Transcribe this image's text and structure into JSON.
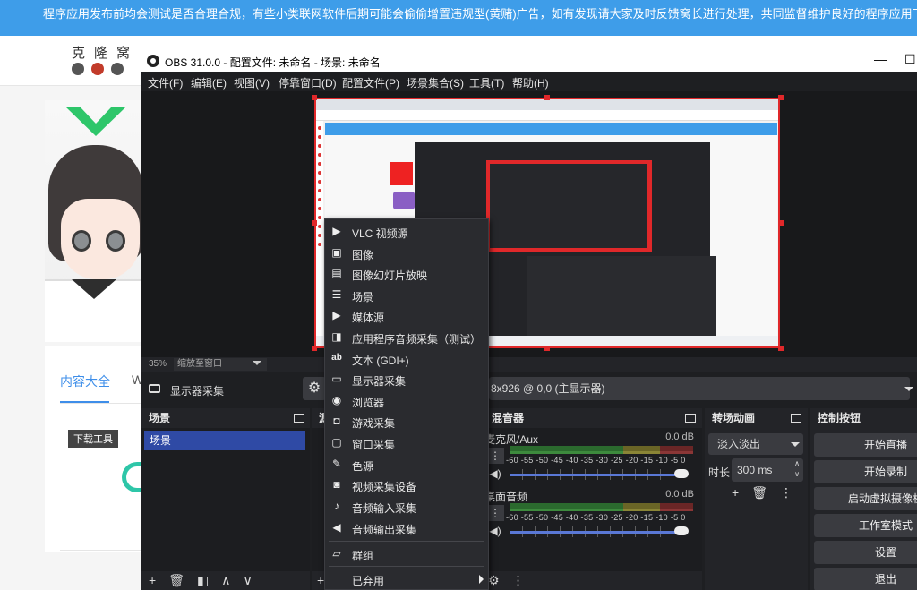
{
  "site": {
    "banner": "程序应用发布前均会测试是否合理合规，有些小类联网软件后期可能会偷偷增置违规型(黄赌)广告，如有发现请大家及时反馈窝长进行处理，共同监督维护良好的程序应用下载社区！",
    "logo": "克隆窝",
    "tab_active": "内容大全",
    "tab_other": "W",
    "tag": "下载工具"
  },
  "obs": {
    "title": "OBS 31.0.0 - 配置文件: 未命名 - 场景: 未命名",
    "minimize": "—",
    "maximize": "☐",
    "menu": [
      "文件(F)",
      "编辑(E)",
      "视图(V)",
      "停靠窗口(D)",
      "配置文件(P)",
      "场景集合(S)",
      "工具(T)",
      "帮助(H)"
    ],
    "zoom_percent": "35%",
    "zoom_mode": "缩放至窗口",
    "source_name": "显示器采集",
    "display_value": "8x926 @ 0,0 (主显示器)",
    "docks": {
      "scenes_title": "场景",
      "sources_title": "源",
      "mixer_title": "混音器",
      "transitions_title": "转场动画",
      "controls_title": "控制按钮"
    },
    "scene_item": "场景",
    "mixer": [
      {
        "name": "麦克风/Aux",
        "db": "0.0 dB"
      },
      {
        "name": "桌面音频",
        "db": "0.0 dB"
      }
    ],
    "meter_ticks": "-60 -55 -50 -45 -40 -35 -30 -25 -20 -15 -10 -5 0",
    "transition_value": "淡入淡出",
    "duration_label": "时长",
    "duration_value": "300 ms",
    "controls": [
      "开始直播",
      "开始录制",
      "启动虚拟摄像机",
      "工作室模式",
      "设置",
      "退出"
    ]
  },
  "context_menu": {
    "items": [
      {
        "icon": "play-icon",
        "glyph": "▶",
        "label": "VLC 视频源"
      },
      {
        "icon": "image-icon",
        "glyph": "▣",
        "label": "图像"
      },
      {
        "icon": "slideshow-icon",
        "glyph": "▤",
        "label": "图像幻灯片放映"
      },
      {
        "icon": "list-icon",
        "glyph": "☰",
        "label": "场景"
      },
      {
        "icon": "play-icon",
        "glyph": "▶",
        "label": "媒体源"
      },
      {
        "icon": "app-audio-icon",
        "glyph": "◨",
        "label": "应用程序音频采集（测试）"
      },
      {
        "icon": "text-icon",
        "glyph": "ab",
        "label": "文本 (GDI+)"
      },
      {
        "icon": "monitor-icon",
        "glyph": "▭",
        "label": "显示器采集"
      },
      {
        "icon": "globe-icon",
        "glyph": "◉",
        "label": "浏览器"
      },
      {
        "icon": "gamepad-icon",
        "glyph": "◘",
        "label": "游戏采集"
      },
      {
        "icon": "window-icon",
        "glyph": "▢",
        "label": "窗口采集"
      },
      {
        "icon": "brush-icon",
        "glyph": "✎",
        "label": "色源"
      },
      {
        "icon": "camera-icon",
        "glyph": "◙",
        "label": "视频采集设备"
      },
      {
        "icon": "microphone-icon",
        "glyph": "♪",
        "label": "音频输入采集"
      },
      {
        "icon": "speaker-icon",
        "glyph": "◀",
        "label": "音频输出采集"
      }
    ],
    "group": {
      "icon": "folder-icon",
      "glyph": "▱",
      "label": "群组"
    },
    "deprecated": "已弃用"
  },
  "colors": {
    "banner": "#3e9de9",
    "selection_red": "#e0282a",
    "scene_selected": "#2f4aa5"
  }
}
